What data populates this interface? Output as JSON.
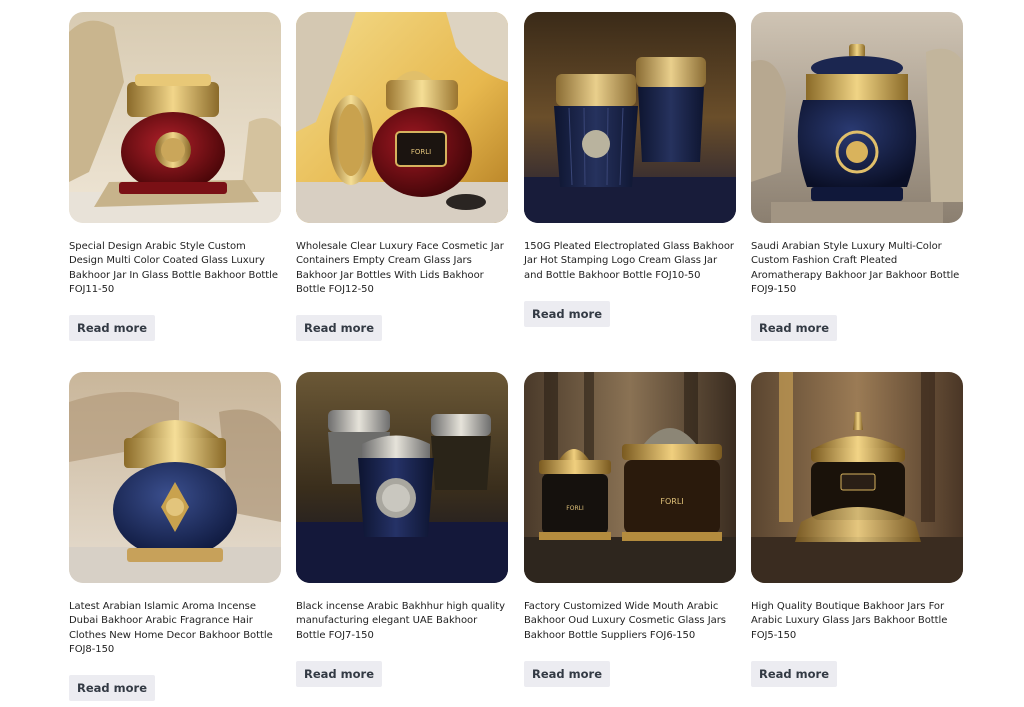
{
  "products": [
    {
      "title": "Special Design Arabic Style Custom Design Multi Color Coated Glass Luxury Bakhoor Jar In Glass Bottle Bakhoor Bottle FOJ11-50",
      "button": "Read more",
      "image_icon": "red-gold-bakhoor-jar-image"
    },
    {
      "title": "Wholesale Clear Luxury Face Cosmetic Jar Containers Empty Cream Glass Jars Bakhoor Jar Bottles With Lids Bakhoor Bottle FOJ12-50",
      "button": "Read more",
      "image_icon": "red-gold-cream-jar-image"
    },
    {
      "title": "150G Pleated Electroplated Glass Bakhoor Jar Hot Stamping Logo Cream Glass Jar and Bottle Bakhoor Bottle FOJ10-50",
      "button": "Read more",
      "image_icon": "navy-pleated-jars-image"
    },
    {
      "title": "Saudi Arabian Style Luxury Multi-Color Custom Fashion Craft Pleated Aromatherapy Bakhoor Jar Bakhoor Bottle FOJ9-150",
      "button": "Read more",
      "image_icon": "navy-gold-urn-jar-image"
    },
    {
      "title": "Latest Arabian Islamic Aroma Incense Dubai Bakhoor Arabic Fragrance Hair Clothes New Home Decor Bakhoor Bottle FOJ8-150",
      "button": "Read more",
      "image_icon": "blue-dome-jar-image"
    },
    {
      "title": "Black incense Arabic Bakhhur high quality manufacturing elegant UAE Bakhoor Bottle FOJ7-150",
      "button": "Read more",
      "image_icon": "three-silver-jars-image"
    },
    {
      "title": "Factory Customized Wide Mouth Arabic Bakhoor Oud Luxury Cosmetic Glass Jars Bakhoor Bottle Suppliers FOJ6-150",
      "button": "Read more",
      "image_icon": "black-gold-jars-image"
    },
    {
      "title": "High Quality Boutique Bakhoor Jars For Arabic Luxury Glass Jars Bakhoor Bottle FOJ5-150",
      "button": "Read more",
      "image_icon": "ornate-gold-jar-image"
    }
  ],
  "colors": {
    "button_bg": "#ececf1",
    "button_text": "#333a44",
    "title_text": "#1f1f1f"
  }
}
